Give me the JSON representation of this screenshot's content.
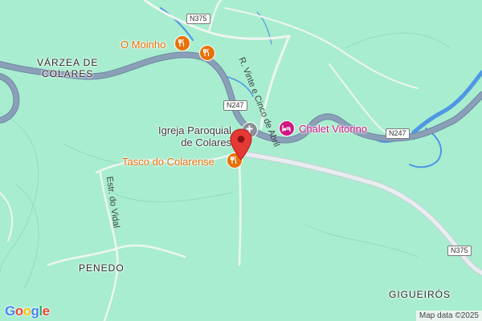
{
  "map": {
    "places": {
      "varzea": "VÁRZEA DE\nCOLARES",
      "penedo": "PENEDO",
      "gigueiros": "GIGUEIRÓS"
    },
    "pois": {
      "moinho": {
        "label": "O Moinho",
        "icon": "restaurant-icon",
        "color": "#e8710a"
      },
      "tasco": {
        "label": "Tasco do Colarense",
        "icon": "restaurant-icon",
        "color": "#e8710a"
      },
      "chalet": {
        "label": "Chalet Vitorino",
        "icon": "hotel-icon",
        "color": "#d01884"
      },
      "igreja": {
        "label": "Igreja Paroquial\nde Colares",
        "icon": "church-icon",
        "color": "#8a8f96"
      }
    },
    "roads": {
      "n375_top": "N375",
      "n247_mid": "N247",
      "n247_right": "N247",
      "n375_bottom": "N375",
      "street_vinte": "R. Vinte e Cinco de Abril",
      "street_vidal": "Estr. do Vidal"
    },
    "pin": {
      "icon": "map-pin-icon",
      "color": "#e53935"
    },
    "logo": {
      "letters": [
        "G",
        "o",
        "o",
        "g",
        "l",
        "e"
      ],
      "colors": [
        "#4285f4",
        "#ea4335",
        "#fbbc05",
        "#4285f4",
        "#34a853",
        "#ea4335"
      ]
    },
    "attribution": "Map data ©2025",
    "colors": {
      "land": "#a8edcf",
      "road_major": "#7f96b1",
      "water": "#4f97e4"
    }
  }
}
